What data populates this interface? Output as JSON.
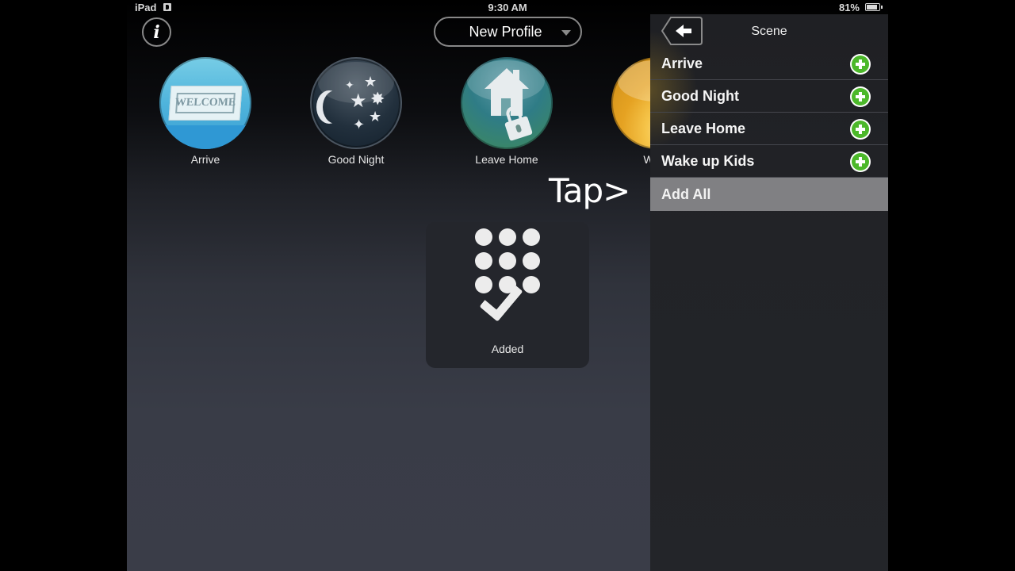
{
  "status_bar": {
    "device": "iPad",
    "time": "9:30 AM",
    "battery": "81%"
  },
  "header": {
    "info_label": "i",
    "profile_select": "New Profile"
  },
  "scenes": [
    {
      "label": "Arrive",
      "icon": "welcome-mat-icon",
      "mat_text": "WELCOME"
    },
    {
      "label": "Good Night",
      "icon": "moon-stars-icon"
    },
    {
      "label": "Leave Home",
      "icon": "house-lock-icon"
    },
    {
      "label": "Wake",
      "icon": "sunrise-icon"
    }
  ],
  "annotation": {
    "text": "Tap>"
  },
  "toast": {
    "label": "Added",
    "icon": "keypad-check-icon"
  },
  "panel": {
    "title": "Scene",
    "back_icon": "back-arrow-icon",
    "items": [
      {
        "label": "Arrive",
        "action": "add"
      },
      {
        "label": "Good Night",
        "action": "add"
      },
      {
        "label": "Leave Home",
        "action": "add"
      },
      {
        "label": "Wake up Kids",
        "action": "add"
      }
    ],
    "add_all_label": "Add All"
  },
  "colors": {
    "add_green": "#4cb82a",
    "add_all_bg": "#808083",
    "panel_bg": "#222327"
  }
}
